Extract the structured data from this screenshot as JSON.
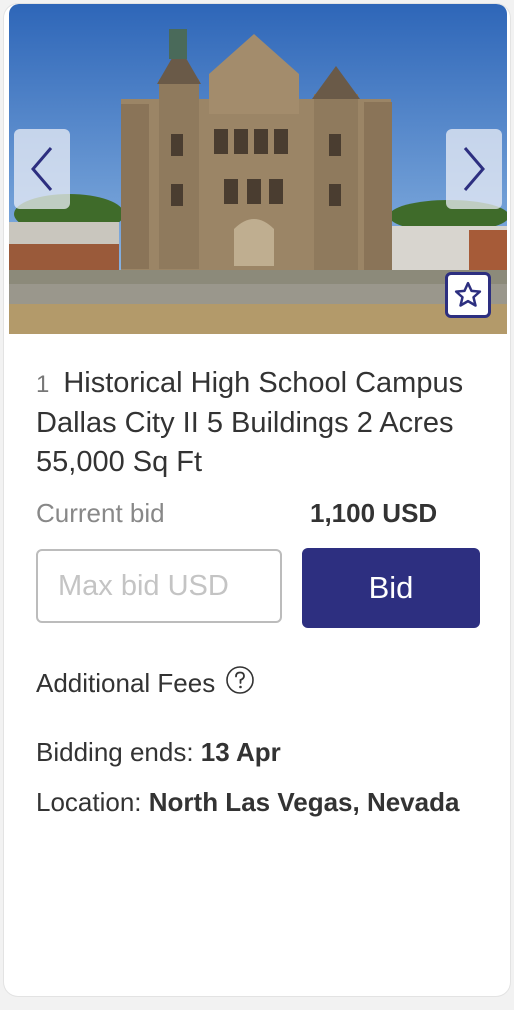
{
  "lot": {
    "number": "1",
    "title": "Historical High School Campus Dallas City II 5 Buildings 2 Acres 55,000 Sq Ft"
  },
  "bid": {
    "current_label": "Current bid",
    "current_value": "1,100 USD",
    "input_placeholder": "Max bid USD",
    "button_label": "Bid"
  },
  "fees": {
    "label": "Additional Fees"
  },
  "details": {
    "ends_label": "Bidding ends:",
    "ends_value": "13 Apr",
    "location_label": "Location:",
    "location_value": "North Las Vegas, Nevada"
  },
  "icons": {
    "prev": "chevron-left-icon",
    "next": "chevron-right-icon",
    "favorite": "star-icon",
    "help": "question-circle-icon"
  },
  "colors": {
    "primary": "#2d2f80",
    "text": "#333333",
    "muted": "#888888"
  }
}
